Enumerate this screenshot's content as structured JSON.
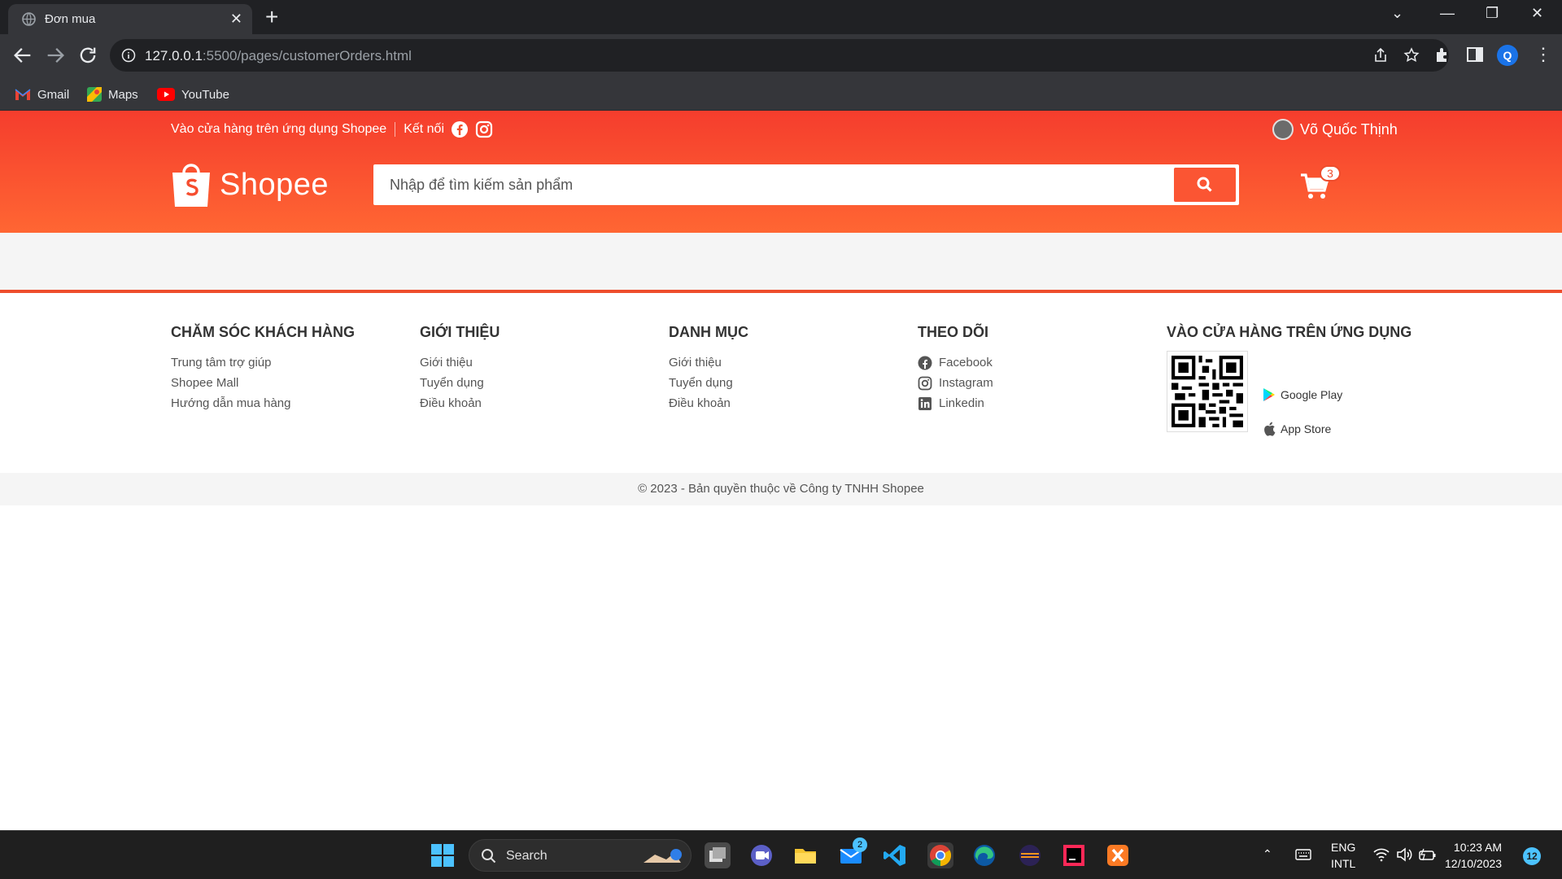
{
  "browser": {
    "tab_title": "Đơn mua",
    "url_host": "127.0.0.1",
    "url_path": ":5500/pages/customerOrders.html",
    "profile_initial": "Q",
    "bookmarks": [
      {
        "label": "Gmail",
        "icon": "gmail-icon"
      },
      {
        "label": "Maps",
        "icon": "maps-icon"
      },
      {
        "label": "YouTube",
        "icon": "youtube-icon"
      }
    ]
  },
  "header": {
    "app_promo": "Vào cửa hàng trên ứng dụng Shopee",
    "connect": "Kết nối",
    "user_name": "Võ Quốc Thịnh",
    "logo_text": "Shopee",
    "search_placeholder": "Nhập để tìm kiếm sản phẩm",
    "cart_count": "3",
    "brand_color": "#ee4d2d"
  },
  "footer": {
    "columns": [
      {
        "title": "CHĂM SÓC KHÁCH HÀNG",
        "links": [
          "Trung tâm trợ giúp",
          "Shopee Mall",
          "Hướng dẫn mua hàng"
        ]
      },
      {
        "title": "GIỚI THIỆU",
        "links": [
          "Giới thiệu",
          "Tuyển dụng",
          "Điều khoản"
        ]
      },
      {
        "title": "DANH MỤC",
        "links": [
          "Giới thiệu",
          "Tuyển dụng",
          "Điều khoản"
        ]
      },
      {
        "title": "THEO DÕI",
        "links": [
          "Facebook",
          "Instagram",
          "Linkedin"
        ]
      }
    ],
    "app_title": "VÀO CỬA HÀNG TRÊN ỨNG DỤNG",
    "google_play": "Google Play",
    "app_store": "App Store",
    "copyright": "© 2023 - Bản quyền thuộc về Công ty TNHH Shopee"
  },
  "taskbar": {
    "search_label": "Search",
    "mail_badge": "2",
    "lang_top": "ENG",
    "lang_bottom": "INTL",
    "time": "10:23 AM",
    "date": "12/10/2023",
    "notification_count": "12"
  }
}
